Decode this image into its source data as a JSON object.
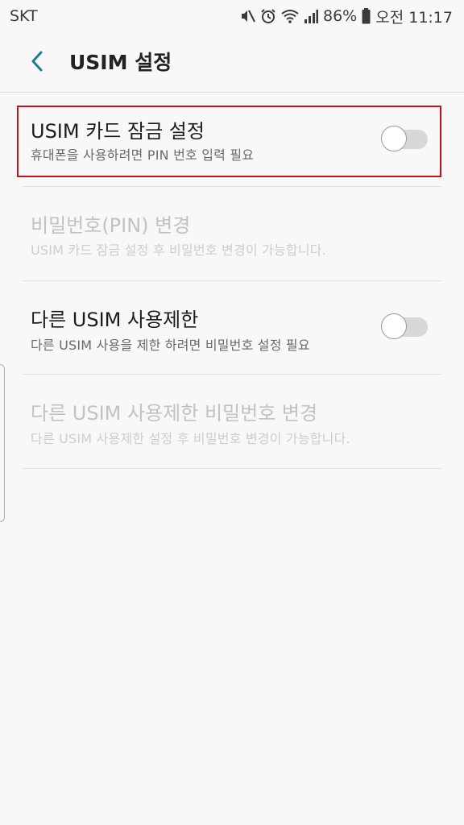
{
  "status_bar": {
    "carrier": "SKT",
    "battery": "86%",
    "time": "오전 11:17",
    "icons": [
      "mute-icon",
      "alarm-icon",
      "wifi-icon",
      "signal-icon",
      "battery-icon"
    ]
  },
  "app_bar": {
    "title": "USIM 설정",
    "back_icon": "back-arrow-icon"
  },
  "colors": {
    "accent": "#1e7f8c",
    "highlight_border": "#c8101e",
    "background": "#f8f8f8"
  },
  "settings": [
    {
      "title": "USIM 카드 잠금 설정",
      "description": "휴대폰을 사용하려면 PIN 번호 입력 필요",
      "enabled": true,
      "toggle": "off"
    },
    {
      "title": "비밀번호(PIN) 변경",
      "description": "USIM 카드 잠금 설정 후 비밀번호 변경이 가능합니다.",
      "enabled": false
    },
    {
      "title": "다른 USIM 사용제한",
      "description": "다른 USIM 사용을 제한 하려면 비밀번호 설정 필요",
      "enabled": true,
      "toggle": "off"
    },
    {
      "title": "다른 USIM 사용제한 비밀번호 변경",
      "description": "다른 USIM 사용제한 설정 후 비밀번호 변경이 가능합니다.",
      "enabled": false
    }
  ]
}
